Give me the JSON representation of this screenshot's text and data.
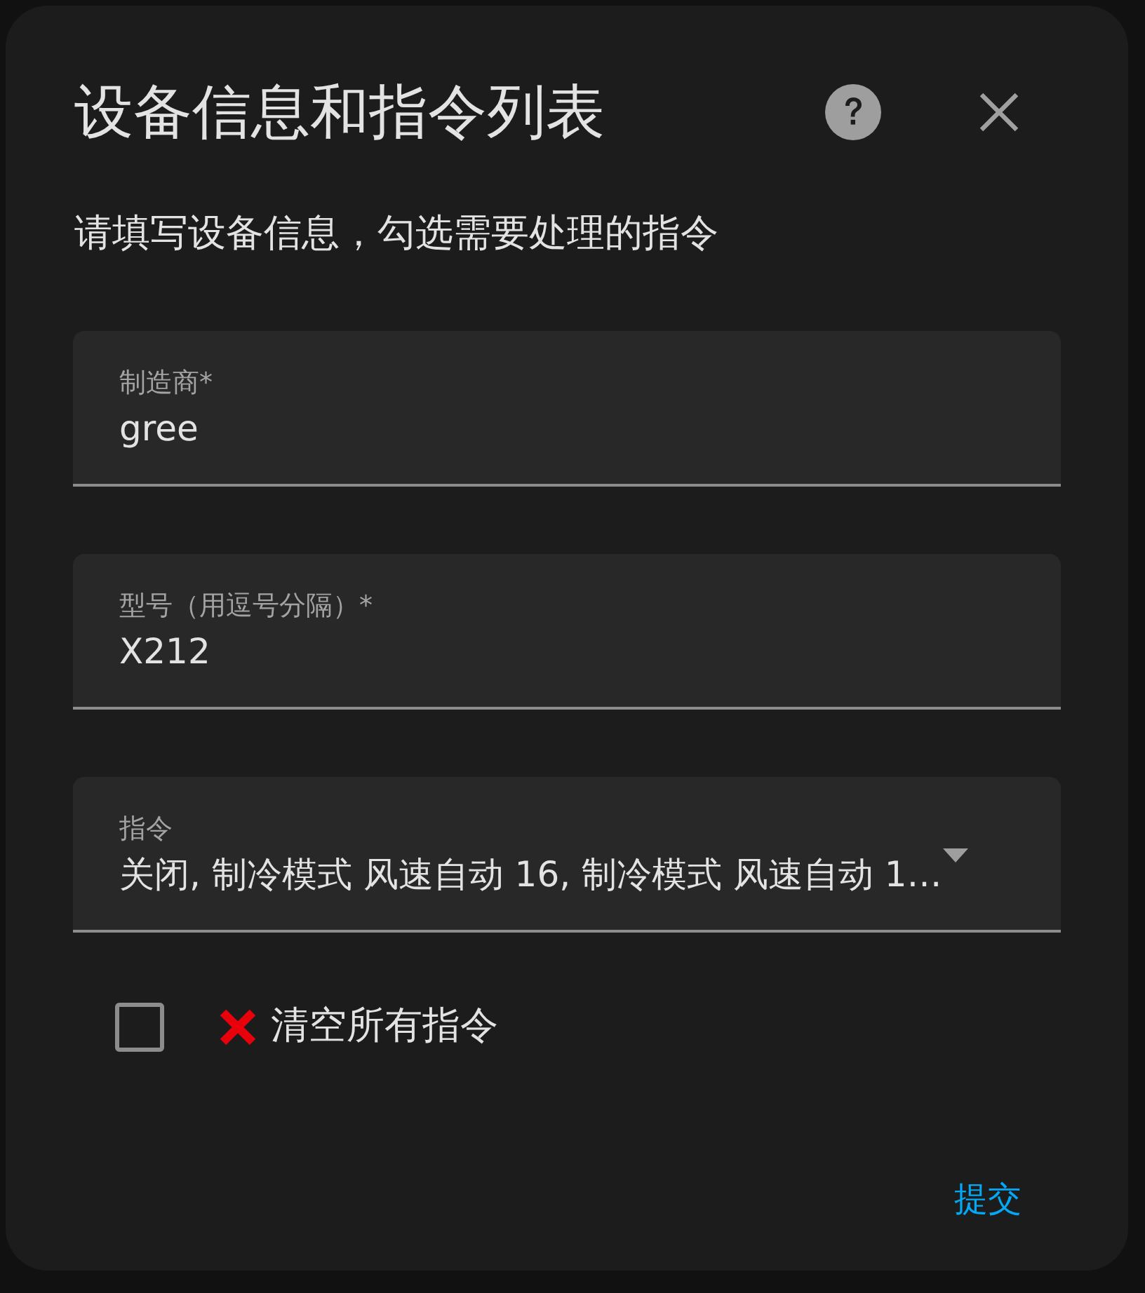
{
  "dialog": {
    "title": "设备信息和指令列表",
    "description": "请填写设备信息，勾选需要处理的指令"
  },
  "fields": [
    {
      "kind": "text",
      "label": "制造商*",
      "value": "gree"
    },
    {
      "kind": "text",
      "label": "型号（用逗号分隔）*",
      "value": "X212"
    },
    {
      "kind": "select",
      "label": "指令",
      "value": "关闭, 制冷模式 风速自动 16, 制冷模式 风速自动 1…"
    }
  ],
  "clear_option": {
    "label": "清空所有指令",
    "checked": false
  },
  "actions": [
    {
      "label": "提交"
    }
  ]
}
